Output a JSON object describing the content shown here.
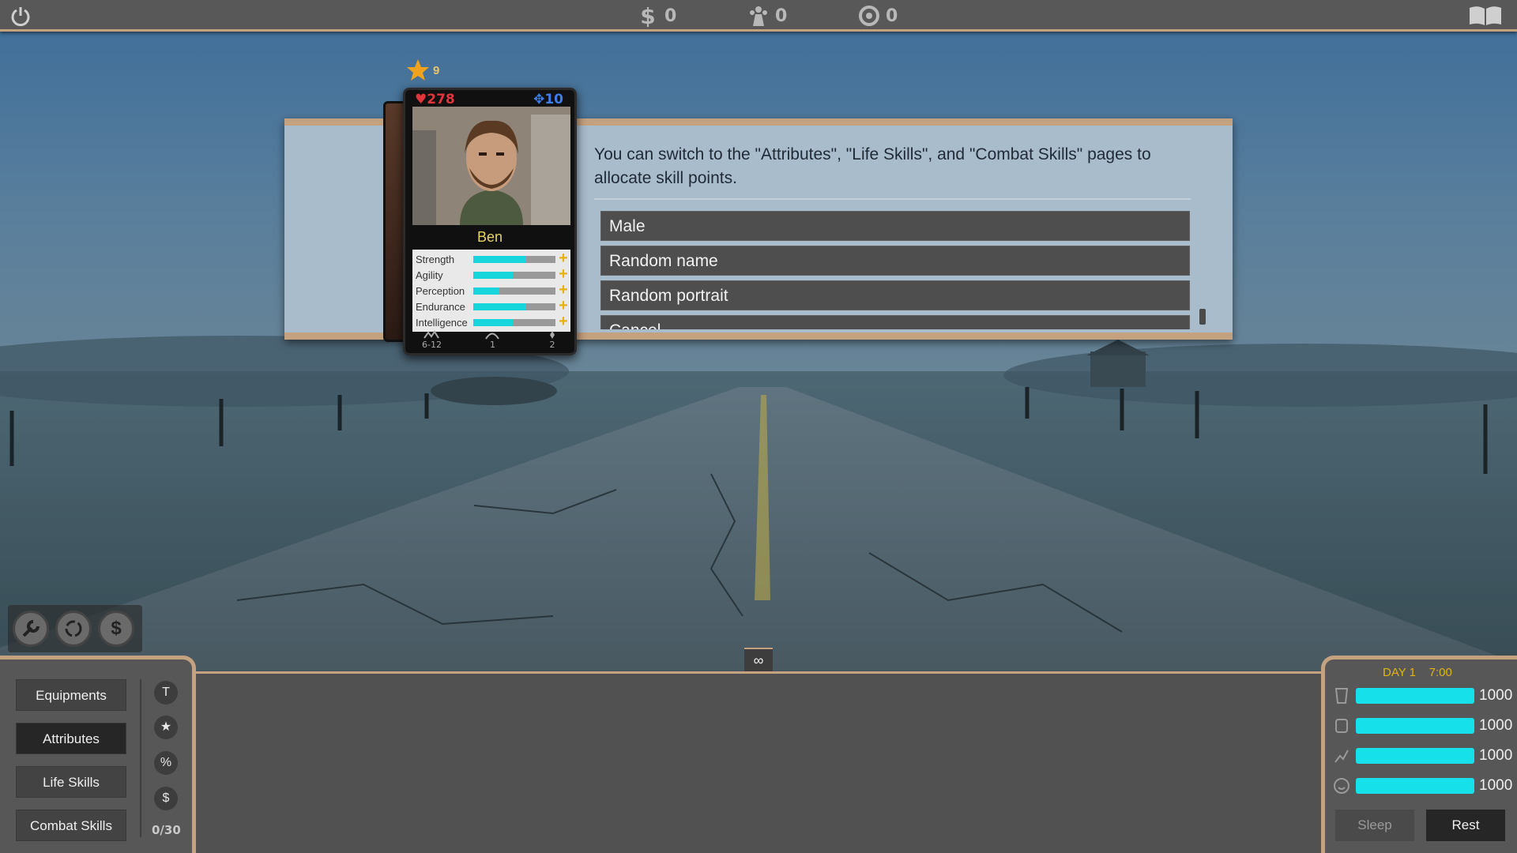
{
  "topbar": {
    "money": "0",
    "population": "0",
    "parts": "0"
  },
  "dialog": {
    "message": "You can switch to the \"Attributes\", \"Life Skills\", and \"Combat Skills\" pages to allocate skill points.",
    "options": [
      "Male",
      "Random name",
      "Random portrait",
      "Cancel"
    ]
  },
  "card": {
    "level": "9",
    "hp": "278",
    "ap": "10",
    "name": "Ben",
    "stats": [
      {
        "label": "Strength",
        "value": 0.64
      },
      {
        "label": "Agility",
        "value": 0.48
      },
      {
        "label": "Perception",
        "value": 0.32
      },
      {
        "label": "Endurance",
        "value": 0.64
      },
      {
        "label": "Intelligence",
        "value": 0.48
      }
    ],
    "footer": {
      "damage": "6-12",
      "range": "1",
      "moves": "2"
    }
  },
  "tools": [
    "wrench-icon",
    "recycle-icon",
    "dollar-icon"
  ],
  "nav": {
    "equipments": "Equipments",
    "attributes": "Attributes",
    "life_skills": "Life Skills",
    "combat_skills": "Combat Skills"
  },
  "side_icons": [
    "T",
    "★",
    "%",
    "$"
  ],
  "skill_points": "0/30",
  "center_tab": "∞",
  "status": {
    "day": "DAY 1",
    "time": "7:00",
    "needs": [
      {
        "icon": "water-icon",
        "value": "1000"
      },
      {
        "icon": "food-icon",
        "value": "1000"
      },
      {
        "icon": "energy-icon",
        "value": "1000"
      },
      {
        "icon": "mood-icon",
        "value": "1000"
      }
    ],
    "sleep": "Sleep",
    "rest": "Rest"
  },
  "colors": {
    "accent": "#c4a17f",
    "bar": "#16e1ea",
    "gold": "#e3b50c",
    "hp": "#e0353b",
    "ap": "#3d7ee8"
  }
}
